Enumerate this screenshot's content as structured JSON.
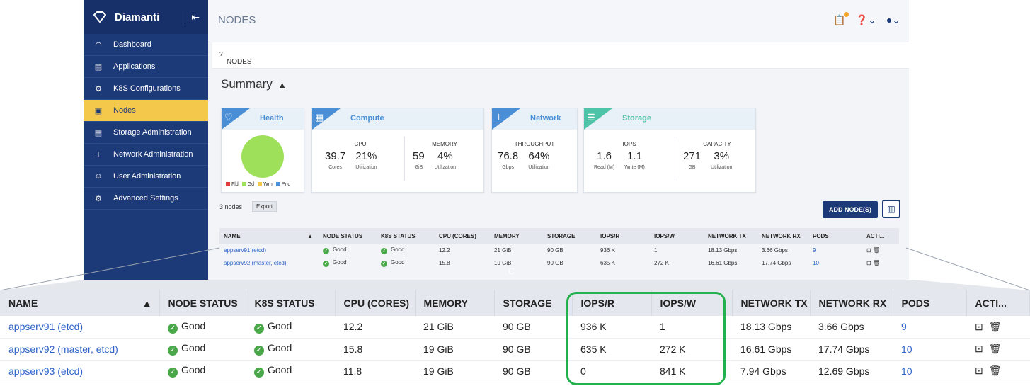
{
  "brand": {
    "name": "Diamanti"
  },
  "sidebar": {
    "items": [
      {
        "label": "Dashboard"
      },
      {
        "label": "Applications"
      },
      {
        "label": "K8S Configurations"
      },
      {
        "label": "Nodes"
      },
      {
        "label": "Storage Administration"
      },
      {
        "label": "Network Administration"
      },
      {
        "label": "User Administration"
      },
      {
        "label": "Advanced Settings"
      }
    ]
  },
  "topbar": {
    "title": "NODES"
  },
  "breadcrumb": {
    "label": "NODES"
  },
  "summary": {
    "title": "Summary",
    "health": {
      "title": "Health",
      "legend": [
        "Fld",
        "Gd",
        "Wrn",
        "Pnd"
      ]
    },
    "compute": {
      "title": "Compute",
      "cpu": {
        "label": "CPU",
        "cores": "39.7",
        "cores_unit": "Cores",
        "util": "21%",
        "util_unit": "Utilization"
      },
      "memory": {
        "label": "MEMORY",
        "value": "59",
        "value_unit": "GiB",
        "util": "4%",
        "util_unit": "Utilization"
      }
    },
    "network": {
      "title": "Network",
      "throughput": {
        "label": "THROUGHPUT",
        "value": "76.8",
        "value_unit": "Gbps",
        "util": "64%",
        "util_unit": "Utilization"
      }
    },
    "storage": {
      "title": "Storage",
      "iops": {
        "label": "IOPS",
        "read": "1.6",
        "read_unit": "Read (M)",
        "write": "1.1",
        "write_unit": "Write (M)"
      },
      "capacity": {
        "label": "CAPACITY",
        "value": "271",
        "value_unit": "GB",
        "util": "3%",
        "util_unit": "Utilization"
      }
    }
  },
  "toolbar": {
    "count": "3 nodes",
    "export": "Export",
    "add": "ADD NODE(S)"
  },
  "table": {
    "headers": [
      "NAME",
      "NODE STATUS",
      "K8S STATUS",
      "CPU (CORES)",
      "MEMORY",
      "STORAGE",
      "IOPS/R",
      "IOPS/W",
      "NETWORK TX",
      "NETWORK RX",
      "PODS",
      "ACTI..."
    ],
    "rows": [
      {
        "name": "appserv91 (etcd)",
        "node_status": "Good",
        "k8s_status": "Good",
        "cpu": "12.2",
        "memory": "21 GiB",
        "storage": "90 GB",
        "iops_r": "936 K",
        "iops_w": "1",
        "net_tx": "18.13 Gbps",
        "net_rx": "3.66 Gbps",
        "pods": "9"
      },
      {
        "name": "appserv92 (master, etcd)",
        "node_status": "Good",
        "k8s_status": "Good",
        "cpu": "15.8",
        "memory": "19 GiB",
        "storage": "90 GB",
        "iops_r": "635 K",
        "iops_w": "272 K",
        "net_tx": "16.61 Gbps",
        "net_rx": "17.74 Gbps",
        "pods": "10"
      },
      {
        "name": "appserv93 (etcd)",
        "node_status": "Good",
        "k8s_status": "Good",
        "cpu": "11.8",
        "memory": "19 GiB",
        "storage": "90 GB",
        "iops_r": "0",
        "iops_w": "841 K",
        "net_tx": "7.94 Gbps",
        "net_rx": "12.69 Gbps",
        "pods": "10"
      }
    ]
  },
  "colors": {
    "sidebar": "#1d3a78",
    "active": "#f4c84a",
    "accent": "#4a8fd6",
    "good": "#4aa84a",
    "highlight": "#23b14d"
  },
  "icons": {
    "logo": "diamond-icon",
    "status": "check-circle-icon",
    "terminal": "terminal-icon",
    "delete": "trash-icon"
  }
}
